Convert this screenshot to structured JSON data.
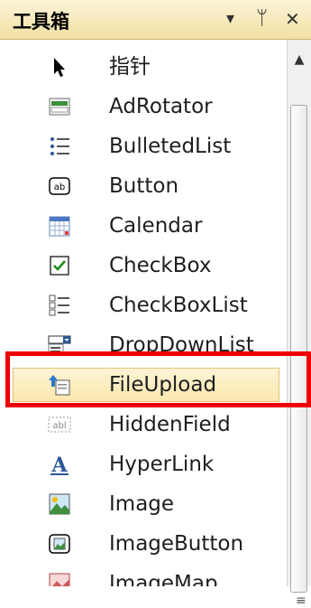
{
  "panel": {
    "title": "工具箱",
    "dropdown_glyph": "▾",
    "pin_glyph": "ᛘ",
    "close_glyph": "✕"
  },
  "scrollbar": {
    "up_glyph": "▲",
    "grip_glyph": "≡"
  },
  "items": [
    {
      "label": "指针",
      "icon": "pointer-icon"
    },
    {
      "label": "AdRotator",
      "icon": "adrotator-icon"
    },
    {
      "label": "BulletedList",
      "icon": "bulleted-list-icon"
    },
    {
      "label": "Button",
      "icon": "button-icon"
    },
    {
      "label": "Calendar",
      "icon": "calendar-icon"
    },
    {
      "label": "CheckBox",
      "icon": "checkbox-icon"
    },
    {
      "label": "CheckBoxList",
      "icon": "checkbox-list-icon"
    },
    {
      "label": "DropDownList",
      "icon": "dropdown-list-icon"
    },
    {
      "label": "FileUpload",
      "icon": "file-upload-icon"
    },
    {
      "label": "HiddenField",
      "icon": "hidden-field-icon"
    },
    {
      "label": "HyperLink",
      "icon": "hyperlink-icon"
    },
    {
      "label": "Image",
      "icon": "image-icon"
    },
    {
      "label": "ImageButton",
      "icon": "image-button-icon"
    },
    {
      "label": "ImageMap",
      "icon": "image-map-icon"
    }
  ],
  "button_icon_text": "ab",
  "hidden_field_icon_text": "abl",
  "hyperlink_icon_text": "A",
  "colors": {
    "selection_border": "#e2c275",
    "annotation_red": "#ef0000",
    "icon_blue": "#2b5797",
    "check_green": "#1a8a1a"
  }
}
